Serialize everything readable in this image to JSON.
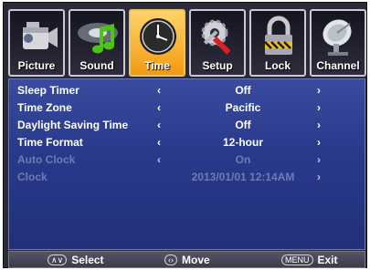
{
  "tabs": [
    {
      "label": "Picture",
      "icon": "camcorder-icon"
    },
    {
      "label": "Sound",
      "icon": "music-note-icon"
    },
    {
      "label": "Time",
      "icon": "clock-icon",
      "active": true
    },
    {
      "label": "Setup",
      "icon": "tools-icon"
    },
    {
      "label": "Lock",
      "icon": "padlock-icon"
    },
    {
      "label": "Channel",
      "icon": "satellite-dish-icon"
    }
  ],
  "menu": {
    "rows": [
      {
        "name": "Sleep Timer",
        "value": "Off",
        "left_arrow": "‹",
        "right_arrow": "›"
      },
      {
        "name": "Time Zone",
        "value": "Pacific",
        "left_arrow": "‹",
        "right_arrow": "›"
      },
      {
        "name": "Daylight Saving Time",
        "value": "Off",
        "left_arrow": "‹",
        "right_arrow": "›"
      },
      {
        "name": "Time Format",
        "value": "12-hour",
        "left_arrow": "‹",
        "right_arrow": "›"
      },
      {
        "name": "Auto Clock",
        "value": "On",
        "left_arrow": "‹",
        "right_arrow": "›"
      },
      {
        "name": "Clock",
        "value": "2013/01/01 12:14AM",
        "left_arrow": "",
        "right_arrow": "›"
      }
    ]
  },
  "footer": {
    "select_key": "∧∨",
    "select_label": "Select",
    "move_key": "‹›",
    "move_label": "Move",
    "menu_key": "MENU",
    "exit_label": "Exit"
  },
  "colors": {
    "active_tab": "#f29a12",
    "panel": "#2a3a8c",
    "disabled_text": "#6f7bb3"
  }
}
